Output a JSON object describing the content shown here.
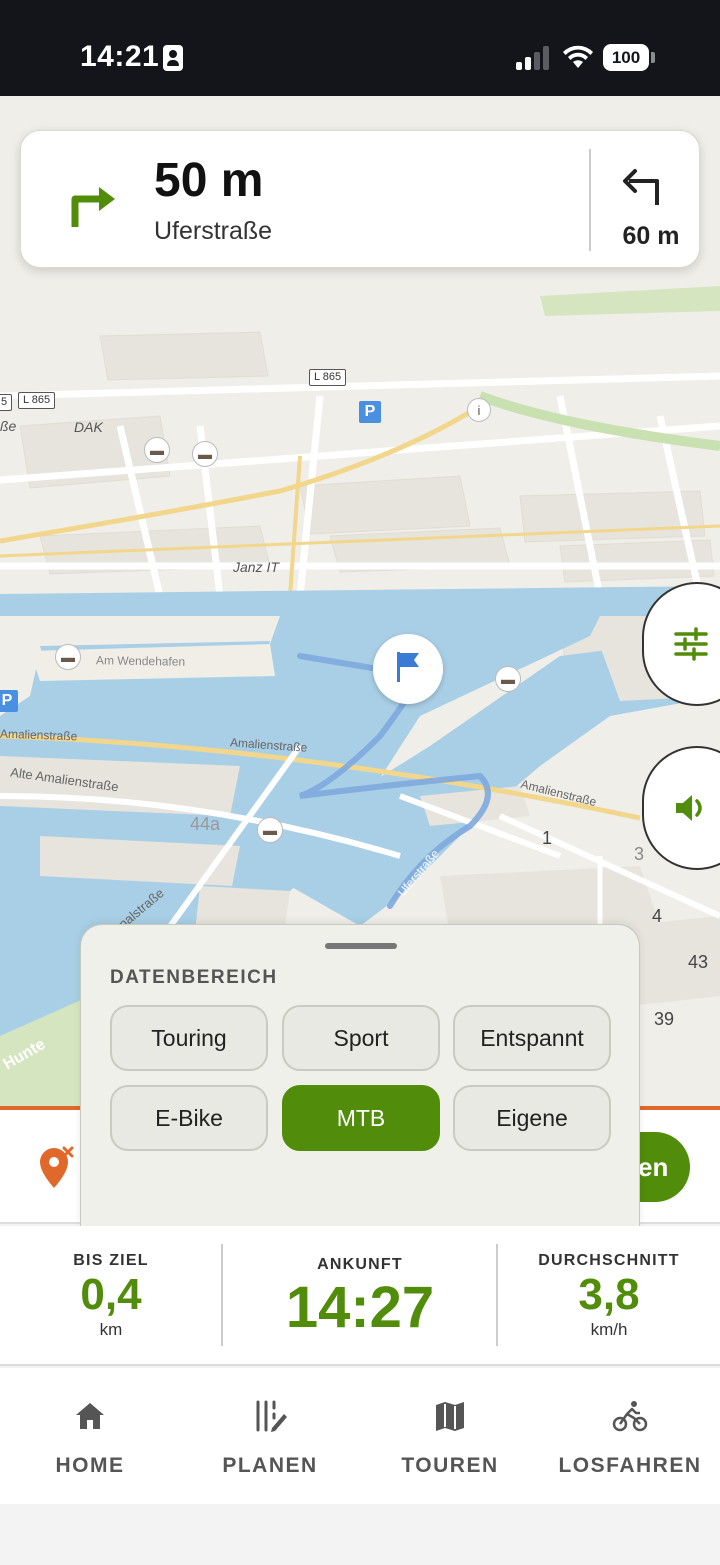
{
  "status_bar": {
    "time": "14:21",
    "battery": "100"
  },
  "navigation": {
    "distance": "50 m",
    "street": "Uferstraße",
    "next_distance": "60 m"
  },
  "map": {
    "labels": {
      "road_l865_a": "L 865",
      "road_l865_b": "L 865",
      "road_edge": "5",
      "dak": "DAK",
      "sse": "ße",
      "janz": "Janz IT",
      "am_wendehafen": "Am Wendehafen",
      "amalienstrasse_1": "Amalienstraße",
      "amalienstrasse_2": "Amalienstraße",
      "amalienstrasse_3": "Amalienstraße",
      "alte_amalienstrasse": "Alte Amalienstraße",
      "kanalstrasse": "Kanalstraße",
      "uferstrasse": "Uferstraße",
      "hunte": "Hunte",
      "no_44a": "44a",
      "no_1": "1",
      "no_3": "3",
      "no_4": "4",
      "no_43": "43",
      "no_39": "39",
      "parking": "P"
    }
  },
  "route_panel": {
    "start_label": "en"
  },
  "sheet": {
    "heading": "DATENBEREICH",
    "options": [
      "Touring",
      "Sport",
      "Entspannt",
      "E-Bike",
      "MTB",
      "Eigene"
    ],
    "selected": "MTB"
  },
  "stats": {
    "remaining": {
      "label": "BIS ZIEL",
      "value": "0,4",
      "unit": "km"
    },
    "arrival": {
      "label": "ANKUNFT",
      "value": "14:27"
    },
    "average": {
      "label": "DURCHSCHNITT",
      "value": "3,8",
      "unit": "km/h"
    }
  },
  "tabs": [
    {
      "label": "HOME",
      "icon": "home-icon"
    },
    {
      "label": "PLANEN",
      "icon": "plan-icon"
    },
    {
      "label": "TOUREN",
      "icon": "map-icon"
    },
    {
      "label": "LOSFAHREN",
      "icon": "bike-icon"
    }
  ],
  "colors": {
    "accent": "#518c0a",
    "route_line": "#e0682a",
    "water": "#a9cfe6"
  }
}
